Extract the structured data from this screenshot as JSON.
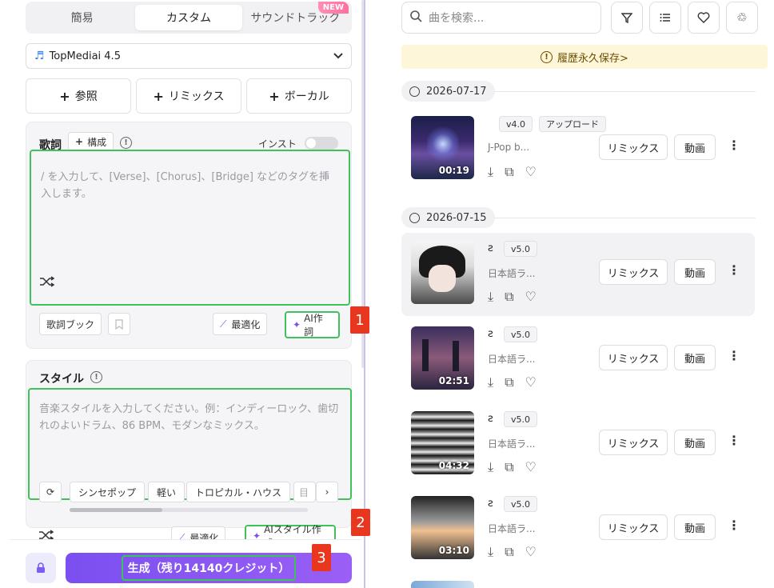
{
  "tabs": {
    "simple": "簡易",
    "custom": "カスタム",
    "soundtrack": "サウンドトラック",
    "new_badge": "NEW"
  },
  "model": {
    "name": "TopMediai 4.5"
  },
  "actions": {
    "reference": "参照",
    "remix": "リミックス",
    "vocal": "ボーカル"
  },
  "lyrics": {
    "title": "歌詞",
    "compose_label": "構成",
    "instrumental_label": "インスト",
    "placeholder": "/ を入力して、[Verse]、[Chorus]、[Bridge] などのタグを挿入します。",
    "lyrics_book": "歌詞ブック",
    "optimize": "最適化",
    "ai_lyrics": "AI作詞"
  },
  "style": {
    "title": "スタイル",
    "placeholder": "音楽スタイルを入力してください。例：インディーロック、歯切れのよいドラム、86 BPM、モダンなミックス。",
    "chips": [
      "シンセポップ",
      "軽い",
      "トロピカル・ハウス",
      "目"
    ],
    "optimize": "最適化",
    "ai_style": "AIスタイル作成"
  },
  "generate": {
    "label": "生成（残り14140クレジット）"
  },
  "markers": [
    "1",
    "2",
    "3"
  ],
  "search": {
    "placeholder": "曲を検索..."
  },
  "banner": {
    "text": "履歴永久保存>"
  },
  "groups": [
    {
      "date": "2026-07-17",
      "tracks": [
        {
          "tags": [
            "v4.0",
            "アップロード"
          ],
          "desc": "J-Pop b...",
          "duration": "00:19",
          "remix": "リミックス",
          "video": "動画"
        }
      ]
    },
    {
      "date": "2026-07-15",
      "tracks": [
        {
          "tags": [
            "v5.0"
          ],
          "desc": "日本語ラ...",
          "duration": "",
          "remix": "リミックス",
          "video": "動画"
        },
        {
          "tags": [
            "v5.0"
          ],
          "desc": "日本語ラ...",
          "duration": "02:51",
          "remix": "リミックス",
          "video": "動画"
        },
        {
          "tags": [
            "v5.0"
          ],
          "desc": "日本語ラ...",
          "duration": "04:32",
          "remix": "リミックス",
          "video": "動画"
        },
        {
          "tags": [
            "v5.0"
          ],
          "desc": "日本語ラ...",
          "duration": "03:10",
          "remix": "リミックス",
          "video": "動画"
        }
      ]
    }
  ],
  "colors": {
    "accent": "#7b4ff0",
    "highlight": "#3fc25a",
    "marker": "#e8361f",
    "banner_bg": "#fdf6d8"
  }
}
